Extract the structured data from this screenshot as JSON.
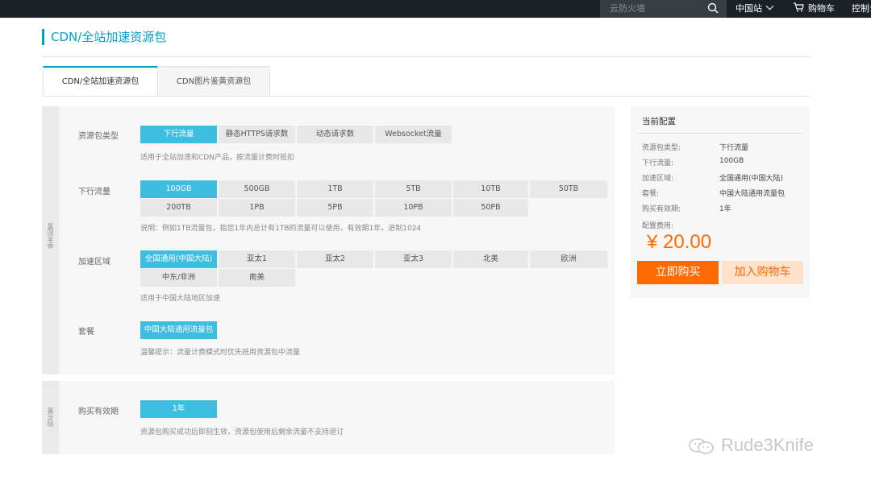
{
  "topbar": {
    "search_placeholder": "云防火墙",
    "region": "中国站",
    "cart": "购物车",
    "console": "控制台"
  },
  "page_title": "CDN/全站加速资源包",
  "tabs": [
    {
      "label": "CDN/全站加速资源包",
      "active": true
    },
    {
      "label": "CDN图片鉴黄资源包",
      "active": false
    }
  ],
  "basic": {
    "side_label": "基本配置",
    "package_type": {
      "label": "资源包类型",
      "options": [
        "下行流量",
        "静态HTTPS请求数",
        "动态请求数",
        "Websocket流量"
      ],
      "selected": 0,
      "hint": "适用于全站加速和CDN产品，按流量计费时抵扣"
    },
    "traffic": {
      "label": "下行流量",
      "options": [
        "100GB",
        "500GB",
        "1TB",
        "5TB",
        "10TB",
        "50TB",
        "200TB",
        "1PB",
        "5PB",
        "10PB",
        "50PB"
      ],
      "selected": 0,
      "hint": "说明：例如1TB流量包，指您1年内总计有1TB的流量可以使用，有效期1年，进制1024"
    },
    "region": {
      "label": "加速区域",
      "options": [
        "全国通用(中国大陆)",
        "亚太1",
        "亚太2",
        "亚太3",
        "北美",
        "欧洲",
        "中东/非洲",
        "南美"
      ],
      "selected": 0,
      "hint": "适用于中国大陆地区加速"
    },
    "plan": {
      "label": "套餐",
      "options": [
        "中国大陆通用流量包"
      ],
      "selected": 0,
      "hint": "温馨提示：流量计费模式时优先抵用资源包中流量"
    }
  },
  "purchase": {
    "side_label": "购买量",
    "validity": {
      "label": "购买有效期",
      "options": [
        "1年"
      ],
      "selected": 0,
      "hint": "资源包购买成功后即刻生效，资源包使用后剩余流量不支持退订"
    }
  },
  "config": {
    "title": "当前配置",
    "rows": [
      {
        "k": "资源包类型:",
        "v": "下行流量"
      },
      {
        "k": "下行流量:",
        "v": "100GB"
      },
      {
        "k": "加速区域:",
        "v": "全国通用(中国大陆)"
      },
      {
        "k": "套餐:",
        "v": "中国大陆通用流量包"
      },
      {
        "k": "购买有效期:",
        "v": "1年"
      }
    ],
    "fee_label": "配置费用:",
    "price": "¥ 20.00",
    "buy_label": "立即购买",
    "cart_label": "加入购物车"
  },
  "watermark": "Rude3Knife",
  "colors": {
    "accent": "#00a2ca",
    "selected": "#3dbde0",
    "orange": "#ff6a00"
  }
}
